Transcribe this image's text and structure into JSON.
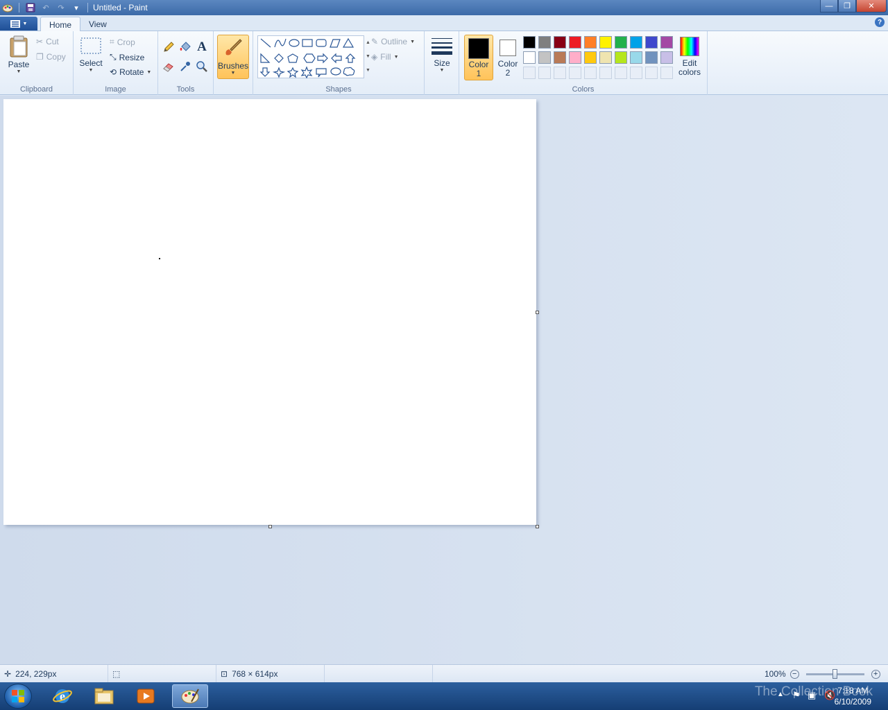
{
  "window": {
    "title": "Untitled - Paint",
    "controls": {
      "minimize": "—",
      "restore": "❐",
      "close": "✕"
    }
  },
  "tabs": [
    {
      "label": "Home",
      "active": true
    },
    {
      "label": "View",
      "active": false
    }
  ],
  "ribbon": {
    "clipboard": {
      "group_label": "Clipboard",
      "paste": "Paste",
      "cut": "Cut",
      "copy": "Copy"
    },
    "image": {
      "group_label": "Image",
      "select": "Select",
      "crop": "Crop",
      "resize": "Resize",
      "rotate": "Rotate"
    },
    "tools": {
      "group_label": "Tools"
    },
    "brushes": {
      "label": "Brushes"
    },
    "shapes": {
      "group_label": "Shapes",
      "outline": "Outline",
      "fill": "Fill"
    },
    "size": {
      "label": "Size"
    },
    "colors": {
      "group_label": "Colors",
      "color1_line1": "Color",
      "color1_line2": "1",
      "color2_line1": "Color",
      "color2_line2": "2",
      "edit_line1": "Edit",
      "edit_line2": "colors",
      "color1": "#000000",
      "color2": "#ffffff",
      "row1": [
        "#000000",
        "#7f7f7f",
        "#880015",
        "#ed1c24",
        "#ff7f27",
        "#fff200",
        "#22b14c",
        "#00a2e8",
        "#3f48cc",
        "#a349a4"
      ],
      "row2": [
        "#ffffff",
        "#c3c3c3",
        "#b97a57",
        "#ffaec9",
        "#ffc90e",
        "#efe4b0",
        "#b5e61d",
        "#99d9ea",
        "#7092be",
        "#c8bfe7"
      ]
    }
  },
  "status": {
    "cursor_pos": "224, 229px",
    "image_size": "768 × 614px",
    "zoom": "100%"
  },
  "taskbar": {
    "watermark": "The Collection Book",
    "time": "7:18 AM",
    "date": "6/10/2009"
  }
}
